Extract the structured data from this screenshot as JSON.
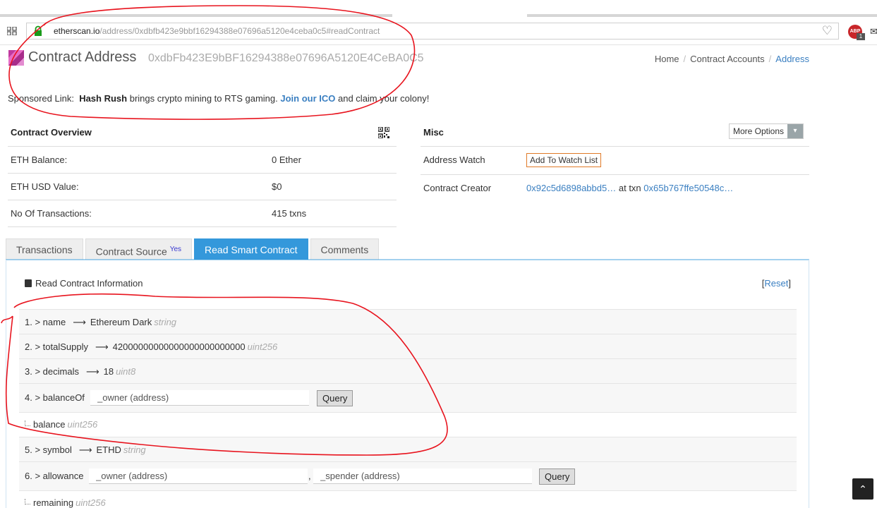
{
  "browser": {
    "url_host": "etherscan.io",
    "url_path": "/address/0xdbfb423e9bbf16294388e07696a5120e4ceba0c5#readContract",
    "abp_label": "ABP",
    "abp_count": "1"
  },
  "header": {
    "title": "Contract Address",
    "address": "0xdbFb423E9bBF16294388e07696A5120E4CeBA0C5",
    "breadcrumb": [
      "Home",
      "Contract Accounts",
      "Address"
    ]
  },
  "sponsor": {
    "prefix": "Sponsored Link:",
    "brand": "Hash Rush",
    "text": "brings crypto mining to RTS gaming.",
    "link": "Join our ICO",
    "suffix": "and claim your colony!"
  },
  "overview": {
    "heading": "Contract Overview",
    "rows": [
      {
        "label": "ETH Balance:",
        "value": "0 Ether"
      },
      {
        "label": "ETH USD Value:",
        "value": "$0"
      },
      {
        "label": "No Of Transactions:",
        "value": "415 txns"
      }
    ]
  },
  "misc": {
    "heading": "Misc",
    "more_options": "More Options",
    "watch_label": "Address Watch",
    "watch_button": "Add To Watch List",
    "creator_label": "Contract Creator",
    "creator_address": "0x92c5d6898abbd5…",
    "at_txn": "at txn",
    "creator_txn": "0x65b767ffe50548c…"
  },
  "tabs": [
    {
      "label": "Transactions"
    },
    {
      "label": "Contract Source",
      "badge": "Yes"
    },
    {
      "label": "Read Smart Contract"
    },
    {
      "label": "Comments"
    }
  ],
  "read": {
    "heading": "Read Contract Information",
    "reset_open": "[",
    "reset": "Reset",
    "reset_close": "]",
    "functions": [
      {
        "label": "1. > name",
        "value": "Ethereum Dark",
        "type": "string"
      },
      {
        "label": "2. > totalSupply",
        "value": "42000000000000000000000000",
        "type": "uint256"
      },
      {
        "label": "3. > decimals",
        "value": "18",
        "type": "uint8"
      },
      {
        "label": "4. > balanceOf",
        "input1": "_owner (address)",
        "button": "Query",
        "output": "balance",
        "output_type": "uint256"
      },
      {
        "label": "5. > symbol",
        "value": "ETHD",
        "type": "string"
      },
      {
        "label": "6. > allowance",
        "input1": "_owner (address)",
        "input2": "_spender (address)",
        "comma": ",",
        "button": "Query",
        "output": "remaining",
        "output_type": "uint256"
      }
    ]
  },
  "annotation_color": "#e8141e"
}
